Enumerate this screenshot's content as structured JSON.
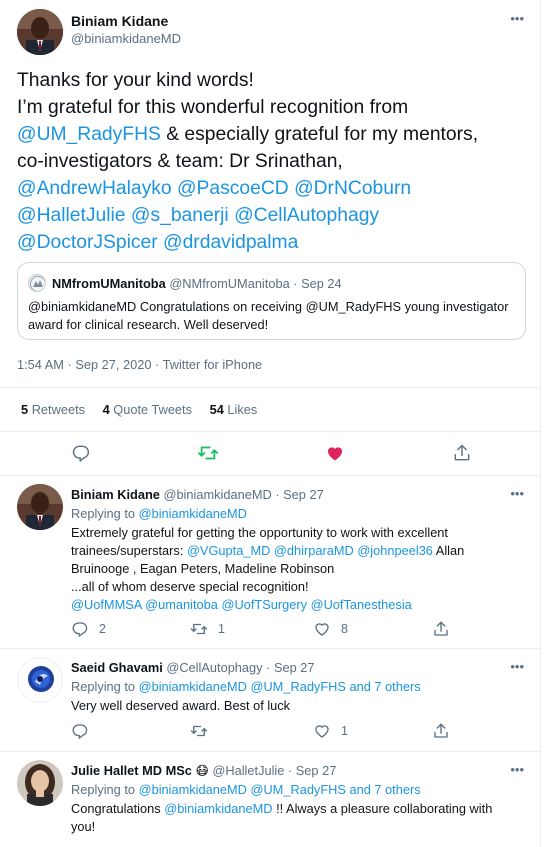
{
  "tweet": {
    "author_name": "Biniam Kidane",
    "author_handle": "@biniamkidaneMD",
    "lines": [
      [
        {
          "t": "Thanks for your kind words!",
          "l": false
        }
      ],
      [
        {
          "t": "I’m grateful for this wonderful recognition from",
          "l": false
        }
      ],
      [
        {
          "t": "@UM_RadyFHS",
          "l": true
        },
        {
          "t": " & especially grateful for my mentors,",
          "l": false
        }
      ],
      [
        {
          "t": "co-investigators & team: Dr Srinathan,",
          "l": false
        }
      ],
      [
        {
          "t": "@AndrewHalayko",
          "l": true
        },
        {
          "t": " ",
          "l": false
        },
        {
          "t": "@PascoeCD",
          "l": true
        },
        {
          "t": " ",
          "l": false
        },
        {
          "t": "@DrNCoburn",
          "l": true
        }
      ],
      [
        {
          "t": "@HalletJulie",
          "l": true
        },
        {
          "t": " ",
          "l": false
        },
        {
          "t": "@s_banerji",
          "l": true
        },
        {
          "t": " ",
          "l": false
        },
        {
          "t": "@CellAutophagy",
          "l": true
        }
      ],
      [
        {
          "t": "@DoctorJSpicer",
          "l": true
        },
        {
          "t": " ",
          "l": false
        },
        {
          "t": "@drdavidpalma",
          "l": true
        }
      ]
    ],
    "quote": {
      "name": "NMfromUManitoba",
      "handle": "@NMfromUManitoba",
      "date": "· Sep 24",
      "text": "@biniamkidaneMD Congratulations on receiving @UM_RadyFHS young investigator award for clinical research. Well deserved!"
    },
    "meta": "1:54 AM · Sep 27, 2020 · Twitter for iPhone",
    "stats": {
      "retweets_count": "5",
      "retweets_label": "Retweets",
      "quotes_count": "4",
      "quotes_label": "Quote Tweets",
      "likes_count": "54",
      "likes_label": "Likes"
    }
  },
  "replies": [
    {
      "name": "Biniam Kidane",
      "handle": "@biniamkidaneMD",
      "date": "· Sep 27",
      "replying_prefix": "Replying to",
      "replying_to": "@biniamkidaneMD",
      "lines": [
        [
          {
            "t": "Extremely grateful for getting the opportunity to work with excellent",
            "l": false
          }
        ],
        [
          {
            "t": "trainees/superstars: ",
            "l": false
          },
          {
            "t": "@VGupta_MD",
            "l": true
          },
          {
            "t": " ",
            "l": false
          },
          {
            "t": "@dhirparaMD",
            "l": true
          },
          {
            "t": " ",
            "l": false
          },
          {
            "t": "@johnpeel36",
            "l": true
          },
          {
            "t": " Allan",
            "l": false
          }
        ],
        [
          {
            "t": "Bruinooge , Eagan Peters, Madeline Robinson",
            "l": false
          }
        ],
        [
          {
            "t": "...all of whom deserve special recognition!",
            "l": false
          }
        ],
        [
          {
            "t": "@UofMMSA",
            "l": true
          },
          {
            "t": " ",
            "l": false
          },
          {
            "t": "@umanitoba",
            "l": true
          },
          {
            "t": " ",
            "l": false
          },
          {
            "t": "@UofTSurgery",
            "l": true
          },
          {
            "t": " ",
            "l": false
          },
          {
            "t": "@UofTanesthesia",
            "l": true
          }
        ]
      ],
      "reply_count": "2",
      "retweet_count": "1",
      "like_count": "8"
    },
    {
      "name": "Saeid Ghavami",
      "handle": "@CellAutophagy",
      "date": "· Sep 27",
      "replying_prefix": "Replying to",
      "replying_to": "@biniamkidaneMD @UM_RadyFHS and 7 others",
      "lines": [
        [
          {
            "t": "Very well deserved award. Best of luck",
            "l": false
          }
        ]
      ],
      "reply_count": "",
      "retweet_count": "",
      "like_count": "1"
    },
    {
      "name": "Julie Hallet MD MSc",
      "emoji": "😷",
      "handle": "@HalletJulie",
      "date": "· Sep 27",
      "replying_prefix": "Replying to",
      "replying_to": "@biniamkidaneMD @UM_RadyFHS and 7 others",
      "lines": [
        [
          {
            "t": "Congratulations ",
            "l": false
          },
          {
            "t": "@biniamkidaneMD",
            "l": true
          },
          {
            "t": " !! Always a pleasure collaborating with",
            "l": false
          }
        ],
        [
          {
            "t": "you!",
            "l": false
          }
        ]
      ]
    }
  ],
  "icons": {
    "more": "more-icon",
    "reply": "reply-icon",
    "retweet": "retweet-icon",
    "like": "heart-icon",
    "share": "share-icon"
  },
  "colors": {
    "link": "#1b95e0",
    "muted": "#5b7083",
    "retweet_green": "#17bf63",
    "like_red": "#e0245e",
    "divider": "#ebeef0"
  }
}
